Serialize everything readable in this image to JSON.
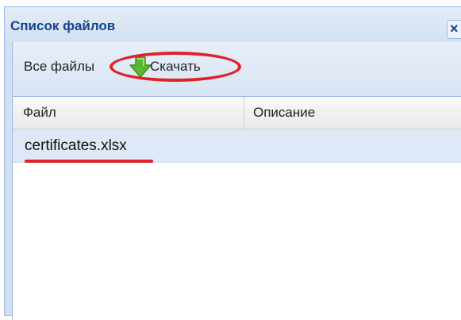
{
  "window": {
    "title": "Список файлов",
    "close_glyph": "×"
  },
  "toolbar": {
    "all_files_label": "Все файлы",
    "download_label": "Скачать",
    "download_icon": "green-down-arrow-icon"
  },
  "grid": {
    "columns": [
      "Файл",
      "Описание"
    ],
    "rows": [
      {
        "file": "certificates.xlsx",
        "description": ""
      }
    ]
  },
  "colors": {
    "title_text": "#15428b",
    "window_border": "#99bbe8",
    "row_selected": "#dfe8f6",
    "annotation_red": "#e0202a",
    "download_icon_green": "#5cb82e"
  }
}
